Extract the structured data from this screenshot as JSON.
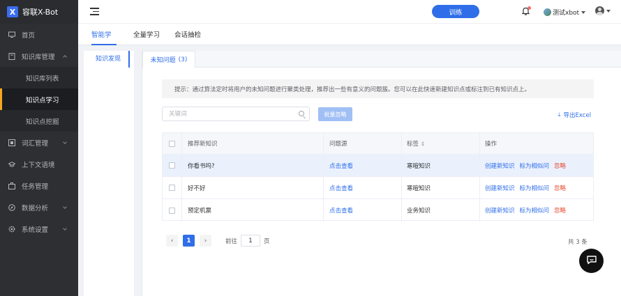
{
  "app": {
    "logo_letter": "X",
    "name": "容联X-Bot"
  },
  "sidebar": {
    "items": [
      {
        "label": "首页",
        "icon": "monitor-icon"
      },
      {
        "label": "知识库管理",
        "icon": "book-icon"
      },
      {
        "label": "知识库列表"
      },
      {
        "label": "知识点学习"
      },
      {
        "label": "知识点挖掘"
      },
      {
        "label": "词汇管理",
        "icon": "dictionary-icon"
      },
      {
        "label": "上下文语境",
        "icon": "graduation-icon"
      },
      {
        "label": "任务管理",
        "icon": "briefcase-icon"
      },
      {
        "label": "数据分析",
        "icon": "compass-icon"
      },
      {
        "label": "系统设置",
        "icon": "gear-icon"
      }
    ],
    "active": "知识点学习"
  },
  "topbar": {
    "train_label": "训练",
    "username": "测试xbot"
  },
  "tabs": [
    {
      "label": "智能学习"
    },
    {
      "label": "全量学习"
    },
    {
      "label": "会话抽检"
    }
  ],
  "leftnav": {
    "item": "知识发现"
  },
  "subtab": {
    "label": "未知问题",
    "count": "(3)"
  },
  "tip": "提示：通过算法定时将用户的未知问题进行聚类处理，推荐出一些有意义的问题簇。您可以在此快速新建知识点或标注到已有知识点上。",
  "search": {
    "placeholder": "关键词"
  },
  "bulk_ignore": "批量忽略",
  "export": "导出Excel",
  "table": {
    "headers": {
      "knowledge": "推荐新知识",
      "source": "问题源",
      "tag": "标签",
      "ops": "操作"
    },
    "rows": [
      {
        "knowledge": "你看书吗?",
        "source": "点击查看",
        "tag": "寒暄知识",
        "op_create": "创建新知识",
        "op_similar": "标为相似问",
        "op_ignore": "忽略"
      },
      {
        "knowledge": "好不好",
        "source": "点击查看",
        "tag": "寒暄知识",
        "op_create": "创建新知识",
        "op_similar": "标为相似问",
        "op_ignore": "忽略"
      },
      {
        "knowledge": "预定机票",
        "source": "点击查看",
        "tag": "业务知识",
        "op_create": "创建新知识",
        "op_similar": "标为相似问",
        "op_ignore": "忽略"
      }
    ]
  },
  "pagination": {
    "prev": "‹",
    "current": "1",
    "next": "›",
    "goto_label": "前往",
    "goto_value": "1",
    "page_unit": "页",
    "total": "共 3 条"
  },
  "colors": {
    "accent": "#2f6ee8",
    "sidebar": "#2d2f33",
    "active_marker": "#f5a623",
    "danger": "#e6472e"
  }
}
